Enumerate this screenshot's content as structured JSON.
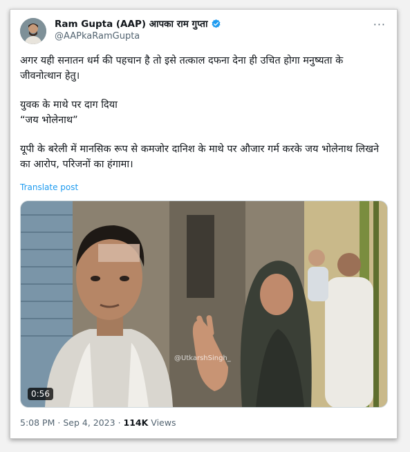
{
  "author": {
    "name": "Ram Gupta (AAP) आपका राम गुप्ता",
    "handle": "@AAPkaRamGupta"
  },
  "post": {
    "paragraph_1": "अगर यही सनातन धर्म की पहचान है तो इसे तत्काल दफना देना ही उचित होगा मनुष्यता के जीवनोत्थान हेतु।",
    "paragraph_2_line_1": "युवक के माथे पर दाग दिया",
    "paragraph_2_line_2": "“जय भोलेनाथ”",
    "paragraph_3": "यूपी के बरेली में मानसिक रूप से कमजोर दानिश के माथे पर औजार गर्म करके जय भोलेनाथ लिखने का आरोप, परिजनों का हंगामा।",
    "translate_label": "Translate post"
  },
  "media": {
    "duration": "0:56",
    "watermark": "@UtkarshSingh_"
  },
  "meta": {
    "time": "5:08 PM",
    "separator": "·",
    "date": "Sep 4, 2023",
    "views_count": "114K",
    "views_label": "Views"
  },
  "icons": {
    "verified": "verified-badge-icon",
    "more": "more-options-icon"
  },
  "colors": {
    "link": "#1d9bf0",
    "verified": "#1d9bf0",
    "secondary_text": "#536471"
  }
}
